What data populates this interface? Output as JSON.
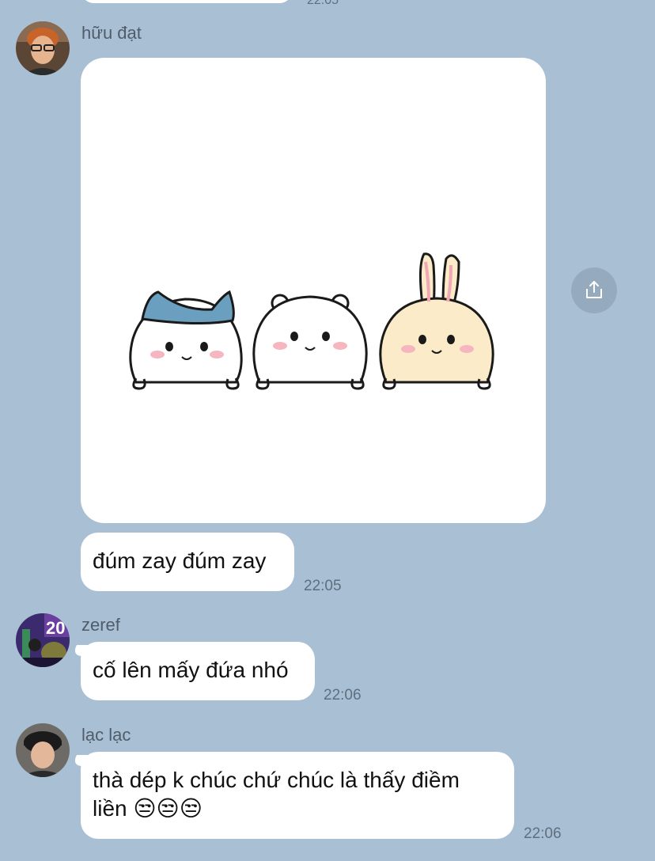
{
  "top_message": {
    "time": "22:05"
  },
  "messages": [
    {
      "sender": "hữu đạt",
      "avatar_icon": "avatar-huu-dat",
      "sticker": "three-cute-characters-sticker",
      "text": "đúm zay đúm zay",
      "time": "22:05"
    },
    {
      "sender": "zeref",
      "avatar_icon": "avatar-zeref",
      "text": "cố lên mấy đứa nhó",
      "time": "22:06"
    },
    {
      "sender": "lạc lạc",
      "avatar_icon": "avatar-lac-lac",
      "text_line1": "thà dép k chúc chứ chúc là thấy điềm",
      "text_line2": "liền 😒😒😒",
      "time": "22:06"
    }
  ],
  "share_icon": "share-icon",
  "colors": {
    "background": "#a9bfd4",
    "bubble": "#ffffff",
    "timestamp": "#5e6f7e",
    "share_button": "#96aabd"
  }
}
